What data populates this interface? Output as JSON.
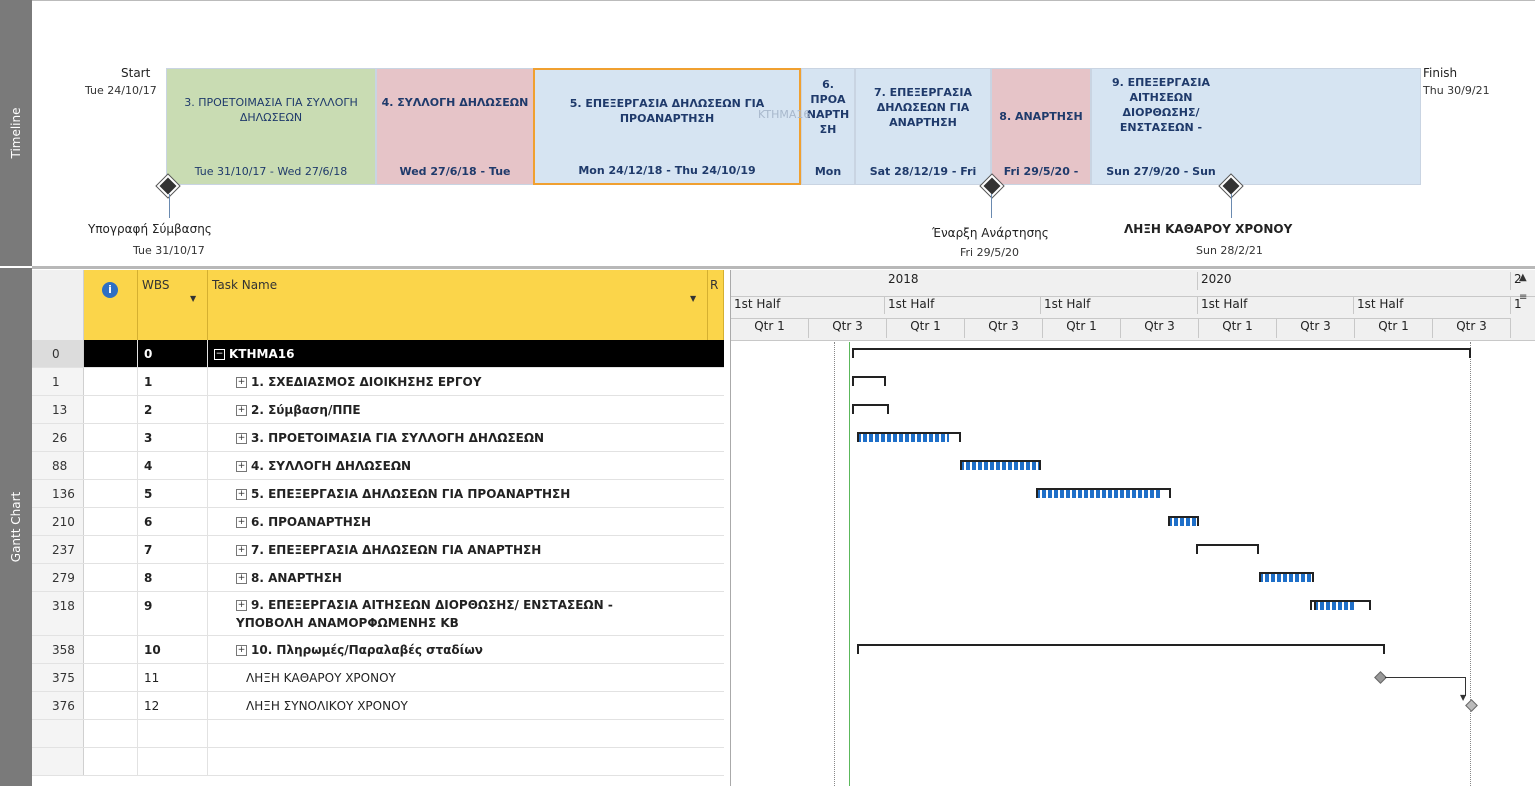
{
  "side_labels": {
    "timeline": "Timeline",
    "gantt": "Gantt Chart"
  },
  "timeline": {
    "start_label": "Start",
    "start_date": "Tue 24/10/17",
    "finish_label": "Finish",
    "finish_date": "Thu 30/9/21",
    "overlay_text": "KTHMA16",
    "bars": [
      {
        "title": "3. ΠΡΟΕΤΟΙΜΑΣΙΑ ΓΙΑ ΣΥΛΛΟΓΗ ΔΗΛΩΣΕΩΝ",
        "dates": "Tue 31/10/17 - Wed 27/6/18",
        "color": "#c9dcb3"
      },
      {
        "title": "4. ΣΥΛΛΟΓΗ ΔΗΛΩΣΕΩΝ",
        "dates": "Wed 27/6/18 - Tue",
        "color": "#e6c4c8"
      },
      {
        "title": "5. ΕΠΕΞΕΡΓΑΣΙΑ ΔΗΛΩΣΕΩΝ ΓΙΑ ΠΡΟΑΝΑΡΤΗΣΗ",
        "dates": "Mon 24/12/18 - Thu 24/10/19",
        "color": "#d6e4f2"
      },
      {
        "title": "6. ΠΡΟΑ ΝΑΡΤΗ ΣΗ",
        "dates": "Mon",
        "color": "#d6e4f2"
      },
      {
        "title": "7. ΕΠΕΞΕΡΓΑΣΙΑ ΔΗΛΩΣΕΩΝ ΓΙΑ ΑΝΑΡΤΗΣΗ",
        "dates": "Sat 28/12/19 - Fri",
        "color": "#d6e4f2"
      },
      {
        "title": "8. ΑΝΑΡΤΗΣΗ",
        "dates": "Fri 29/5/20 -",
        "color": "#e6c4c8"
      },
      {
        "title": "9. ΕΠΕΞΕΡΓΑΣΙΑ ΑΙΤΗΣΕΩΝ ΔΙΟΡΘΩΣΗΣ/ ΕΝΣΤΑΣΕΩΝ -",
        "dates": "Sun 27/9/20 - Sun",
        "color": "#d6e4f2"
      }
    ],
    "milestones": [
      {
        "name": "Υπογραφή Σύμβασης",
        "date": "Tue 31/10/17"
      },
      {
        "name": "Έναρξη Ανάρτησης",
        "date": "Fri 29/5/20"
      },
      {
        "name": "ΛΗΞΗ ΚΑΘΑΡΟΥ ΧΡΟΝΟΥ",
        "date": "Sun 28/2/21"
      }
    ]
  },
  "table": {
    "headers": {
      "wbs": "WBS",
      "task_name": "Task Name",
      "r": "R"
    },
    "rows": [
      {
        "id": "0",
        "wbs": "0",
        "name": "ΚΤΗΜΑ16",
        "expand": "−",
        "selected": true
      },
      {
        "id": "1",
        "wbs": "1",
        "name": "1. ΣΧΕΔΙΑΣΜΟΣ ΔΙΟΙΚΗΣΗΣ ΕΡΓΟΥ",
        "expand": "+"
      },
      {
        "id": "13",
        "wbs": "2",
        "name": "2. Σύμβαση/ΠΠΕ",
        "expand": "+"
      },
      {
        "id": "26",
        "wbs": "3",
        "name": "3. ΠΡΟΕΤΟΙΜΑΣΙΑ ΓΙΑ ΣΥΛΛΟΓΗ ΔΗΛΩΣΕΩΝ",
        "expand": "+"
      },
      {
        "id": "88",
        "wbs": "4",
        "name": "4. ΣΥΛΛΟΓΗ ΔΗΛΩΣΕΩΝ",
        "expand": "+"
      },
      {
        "id": "136",
        "wbs": "5",
        "name": "5. ΕΠΕΞΕΡΓΑΣΙΑ ΔΗΛΩΣΕΩΝ ΓΙΑ ΠΡΟΑΝΑΡΤΗΣΗ",
        "expand": "+"
      },
      {
        "id": "210",
        "wbs": "6",
        "name": "6. ΠΡΟΑΝΑΡΤΗΣΗ",
        "expand": "+"
      },
      {
        "id": "237",
        "wbs": "7",
        "name": "7. ΕΠΕΞΕΡΓΑΣΙΑ ΔΗΛΩΣΕΩΝ ΓΙΑ ΑΝΑΡΤΗΣΗ",
        "expand": "+"
      },
      {
        "id": "279",
        "wbs": "8",
        "name": "8. ΑΝΑΡΤΗΣΗ",
        "expand": "+"
      },
      {
        "id": "318",
        "wbs": "9",
        "name": "9. ΕΠΕΞΕΡΓΑΣΙΑ ΑΙΤΗΣΕΩΝ ΔΙΟΡΘΩΣΗΣ/ ΕΝΣΤΑΣΕΩΝ -",
        "name2": "ΥΠΟΒΟΛΗ ΑΝΑΜΟΡΦΩΜΕΝΗΣ ΚΒ",
        "expand": "+"
      },
      {
        "id": "358",
        "wbs": "10",
        "name": "10. Πληρωμές/Παραλαβές σταδίων",
        "expand": "+"
      },
      {
        "id": "375",
        "wbs": "11",
        "name": "ΛΗΞΗ ΚΑΘΑΡΟΥ ΧΡΟΝΟΥ",
        "expand": "",
        "plain": true
      },
      {
        "id": "376",
        "wbs": "12",
        "name": "ΛΗΞΗ ΣΥΝΟΛΙΚΟΥ ΧΡΟΝΟΥ",
        "expand": "",
        "plain": true
      }
    ]
  },
  "gantt": {
    "years": [
      "2018",
      "2020",
      "2"
    ],
    "halves": [
      "1st Half",
      "1st Half",
      "1st Half",
      "1st Half",
      "1st Half",
      "1"
    ],
    "quarters": [
      "Qtr 1",
      "Qtr 3",
      "Qtr 1",
      "Qtr 3",
      "Qtr 1",
      "Qtr 3",
      "Qtr 1",
      "Qtr 3",
      "Qtr 1",
      "Qtr 3"
    ]
  }
}
